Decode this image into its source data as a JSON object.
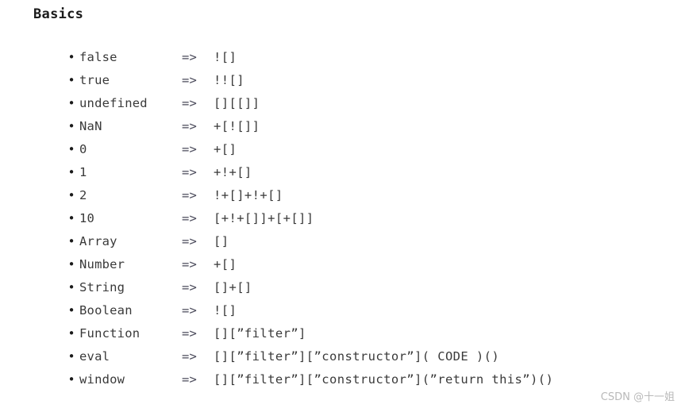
{
  "document": {
    "title": "Basics",
    "bullet_glyph": "•",
    "arrow_glyph": "=>",
    "background_color": "#ffffff",
    "text_color": "#3a3a3a",
    "title_color": "#1a1a1a",
    "watermark_color": "#b9b9b9"
  },
  "rows": [
    {
      "name": "false",
      "arrow": "=>",
      "value": "![]"
    },
    {
      "name": "true",
      "arrow": "=>",
      "value": "!![]"
    },
    {
      "name": "undefined",
      "arrow": "=>",
      "value": "[][[]]"
    },
    {
      "name": "NaN",
      "arrow": "=>",
      "value": "+[![]]"
    },
    {
      "name": "0",
      "arrow": "=>",
      "value": "+[]"
    },
    {
      "name": "1",
      "arrow": "=>",
      "value": "+!+[]"
    },
    {
      "name": "2",
      "arrow": "=>",
      "value": "!+[]+!+[]"
    },
    {
      "name": "10",
      "arrow": "=>",
      "value": "[+!+[]]+[+[]]"
    },
    {
      "name": "Array",
      "arrow": "=>",
      "value": "[]"
    },
    {
      "name": "Number",
      "arrow": "=>",
      "value": "+[]"
    },
    {
      "name": "String",
      "arrow": "=>",
      "value": "[]+[]"
    },
    {
      "name": "Boolean",
      "arrow": "=>",
      "value": "![]"
    },
    {
      "name": "Function",
      "arrow": "=>",
      "value": "[][”filter”]"
    },
    {
      "name": "eval",
      "arrow": "=>",
      "value": "[][”filter”][”constructor”]( CODE )()"
    },
    {
      "name": "window",
      "arrow": "=>",
      "value": "[][”filter”][”constructor”](”return this”)()"
    }
  ],
  "watermark": {
    "text": "CSDN @十一姐"
  }
}
